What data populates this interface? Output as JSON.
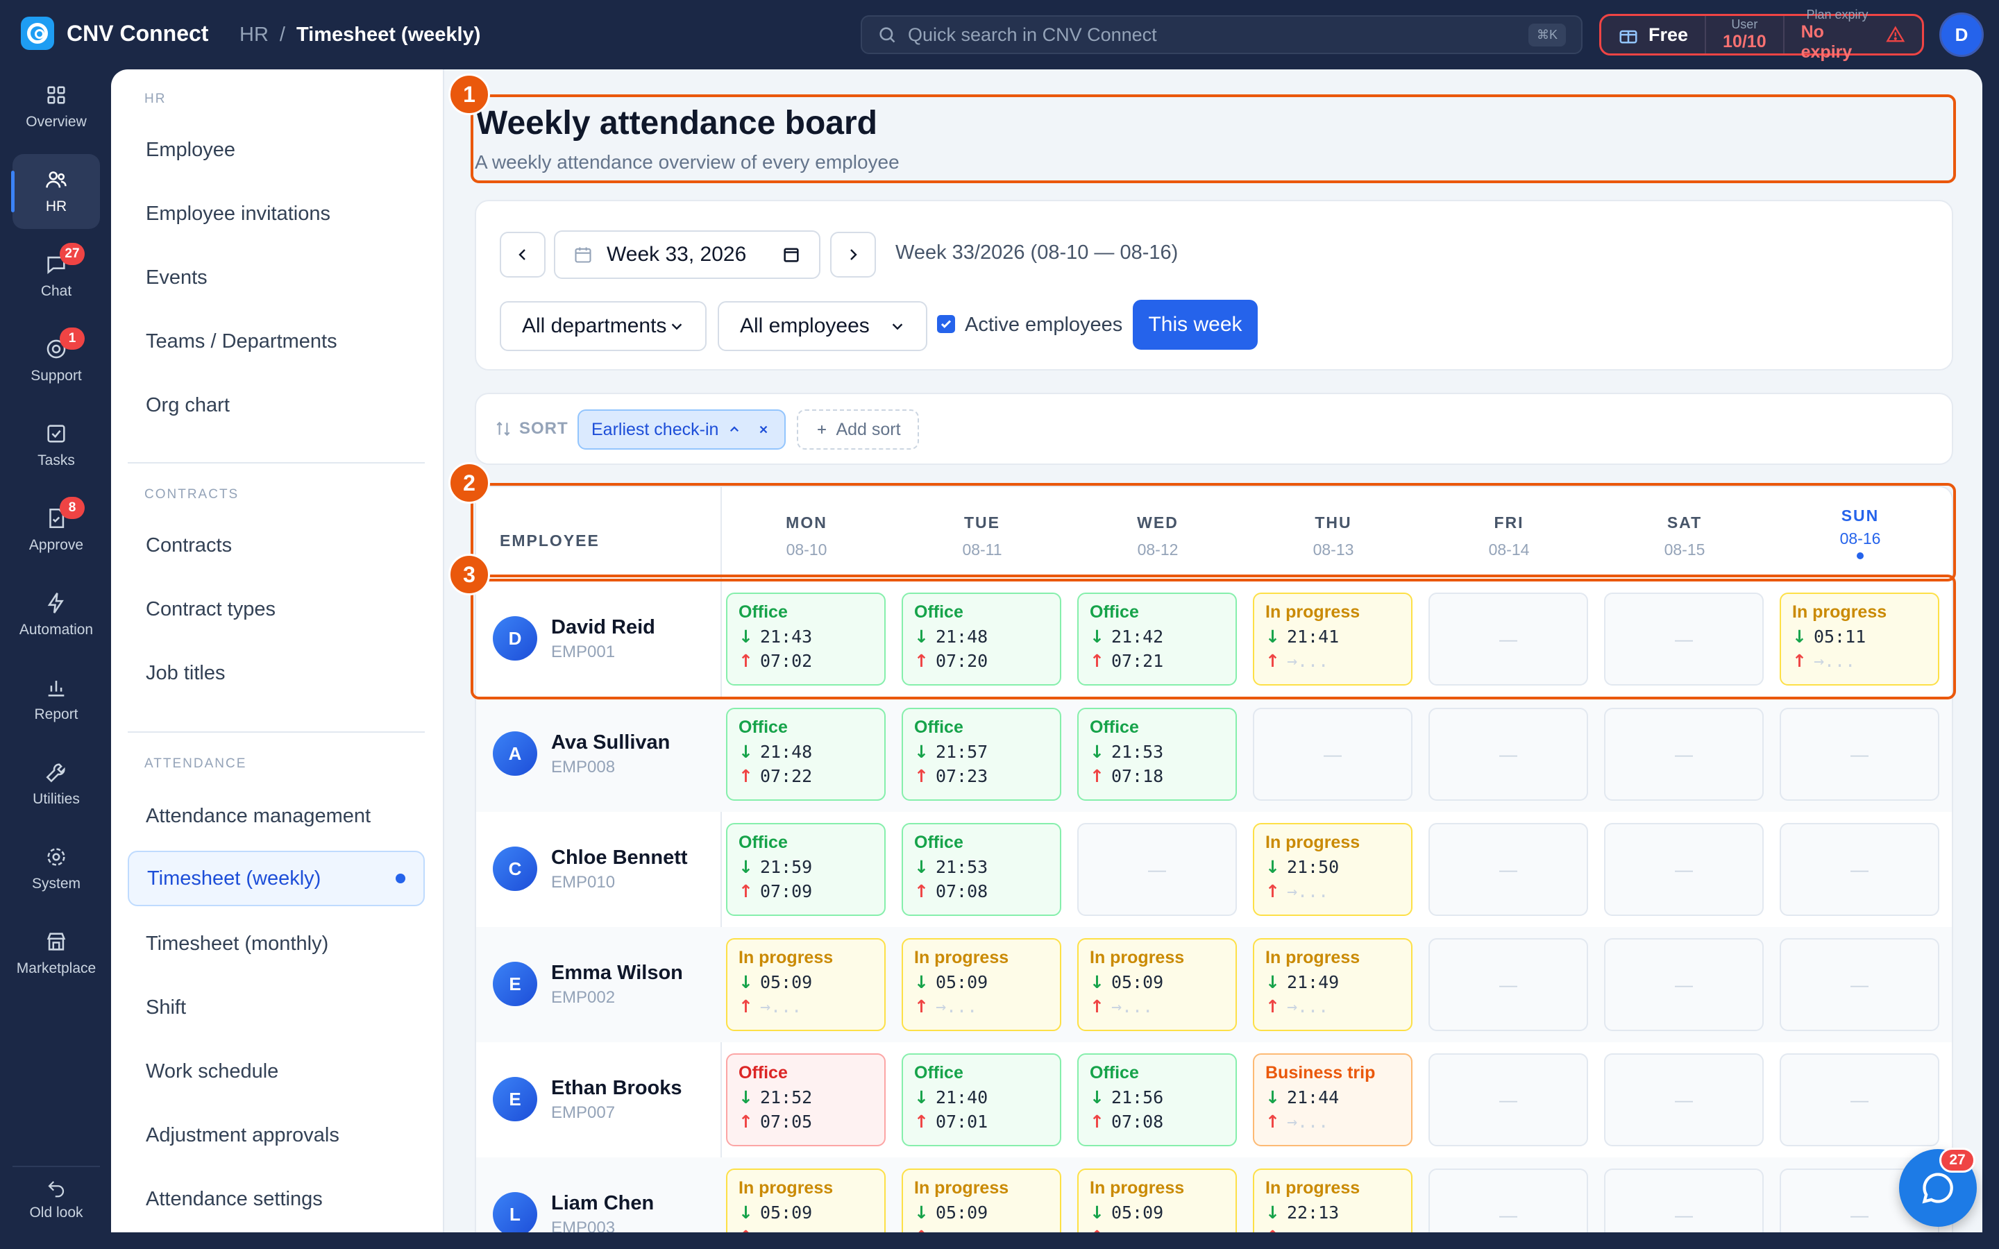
{
  "app": {
    "name": "CNV Connect"
  },
  "breadcrumb": {
    "parent": "HR",
    "separator": "/",
    "current": "Timesheet (weekly)"
  },
  "search": {
    "placeholder": "Quick search in CNV Connect",
    "shortcut": "⌘K"
  },
  "plan": {
    "name": "Free",
    "user_label": "User",
    "user_value": "10/10",
    "expiry_label": "Plan expiry",
    "expiry_value": "No expiry"
  },
  "user": {
    "initial": "D"
  },
  "rail": [
    {
      "label": "Overview",
      "icon": "grid-icon"
    },
    {
      "label": "HR",
      "icon": "users-icon",
      "active": true
    },
    {
      "label": "Chat",
      "icon": "chat-icon",
      "badge": "27"
    },
    {
      "label": "Support",
      "icon": "support-icon",
      "badge": "1"
    },
    {
      "label": "Tasks",
      "icon": "checkbox-icon"
    },
    {
      "label": "Approve",
      "icon": "approve-icon",
      "badge": "8"
    },
    {
      "label": "Automation",
      "icon": "bolt-icon"
    },
    {
      "label": "Report",
      "icon": "bar-chart-icon"
    },
    {
      "label": "Utilities",
      "icon": "wrench-icon"
    },
    {
      "label": "System",
      "icon": "gear-icon"
    },
    {
      "label": "Marketplace",
      "icon": "store-icon"
    }
  ],
  "rail_bottom": {
    "label": "Old look",
    "icon": "undo-icon"
  },
  "subnav": {
    "hr_title": "HR",
    "hr": [
      "Employee",
      "Employee invitations",
      "Events",
      "Teams / Departments",
      "Org chart"
    ],
    "contracts_title": "CONTRACTS",
    "contracts": [
      "Contracts",
      "Contract types",
      "Job titles"
    ],
    "attendance_title": "ATTENDANCE",
    "attendance": [
      "Attendance management",
      "Timesheet (weekly)",
      "Timesheet (monthly)",
      "Shift",
      "Work schedule",
      "Adjustment approvals",
      "Attendance settings"
    ]
  },
  "page": {
    "title": "Weekly attendance board",
    "subtitle": "A weekly attendance overview of every employee"
  },
  "filters": {
    "week_value": "Week 33, 2026",
    "week_range": "Week 33/2026 (08-10 — 08-16)",
    "department": "All departments",
    "employees": "All employees",
    "active_label": "Active employees",
    "active_checked": true,
    "this_week": "This week"
  },
  "sort": {
    "label": "SORT",
    "chip": "Earliest check-in",
    "add": "Add sort"
  },
  "grid": {
    "employee_header": "EMPLOYEE",
    "days": [
      {
        "d": "MON",
        "date": "08-10"
      },
      {
        "d": "TUE",
        "date": "08-11"
      },
      {
        "d": "WED",
        "date": "08-12"
      },
      {
        "d": "THU",
        "date": "08-13"
      },
      {
        "d": "FRI",
        "date": "08-14"
      },
      {
        "d": "SAT",
        "date": "08-15"
      },
      {
        "d": "SUN",
        "date": "08-16",
        "today": true
      }
    ],
    "empty_mark": "—",
    "pending_out": "→...",
    "rows": [
      {
        "initial": "D",
        "name": "David Reid",
        "id": "EMP001",
        "cells": [
          {
            "status": "Office",
            "kind": "office",
            "in": "21:43",
            "out": "07:02"
          },
          {
            "status": "Office",
            "kind": "office",
            "in": "21:48",
            "out": "07:20"
          },
          {
            "status": "Office",
            "kind": "office",
            "in": "21:42",
            "out": "07:21"
          },
          {
            "status": "In progress",
            "kind": "prog",
            "in": "21:41",
            "out": null
          },
          null,
          null,
          {
            "status": "In progress",
            "kind": "prog",
            "in": "05:11",
            "out": null
          }
        ]
      },
      {
        "initial": "A",
        "name": "Ava Sullivan",
        "id": "EMP008",
        "cells": [
          {
            "status": "Office",
            "kind": "office",
            "in": "21:48",
            "out": "07:22"
          },
          {
            "status": "Office",
            "kind": "office",
            "in": "21:57",
            "out": "07:23"
          },
          {
            "status": "Office",
            "kind": "office",
            "in": "21:53",
            "out": "07:18"
          },
          null,
          null,
          null,
          null
        ]
      },
      {
        "initial": "C",
        "name": "Chloe Bennett",
        "id": "EMP010",
        "cells": [
          {
            "status": "Office",
            "kind": "office",
            "in": "21:59",
            "out": "07:09"
          },
          {
            "status": "Office",
            "kind": "office",
            "in": "21:53",
            "out": "07:08"
          },
          null,
          {
            "status": "In progress",
            "kind": "prog",
            "in": "21:50",
            "out": null
          },
          null,
          null,
          null
        ]
      },
      {
        "initial": "E",
        "name": "Emma Wilson",
        "id": "EMP002",
        "cells": [
          {
            "status": "In progress",
            "kind": "prog",
            "in": "05:09",
            "out": null
          },
          {
            "status": "In progress",
            "kind": "prog",
            "in": "05:09",
            "out": null
          },
          {
            "status": "In progress",
            "kind": "prog",
            "in": "05:09",
            "out": null
          },
          {
            "status": "In progress",
            "kind": "prog",
            "in": "21:49",
            "out": null
          },
          null,
          null,
          null
        ]
      },
      {
        "initial": "E",
        "name": "Ethan Brooks",
        "id": "EMP007",
        "cells": [
          {
            "status": "Office",
            "kind": "late",
            "in": "21:52",
            "out": "07:05"
          },
          {
            "status": "Office",
            "kind": "office",
            "in": "21:40",
            "out": "07:01"
          },
          {
            "status": "Office",
            "kind": "office",
            "in": "21:56",
            "out": "07:08"
          },
          {
            "status": "Business trip",
            "kind": "trip",
            "in": "21:44",
            "out": null
          },
          null,
          null,
          null
        ]
      },
      {
        "initial": "L",
        "name": "Liam Chen",
        "id": "EMP003",
        "cells": [
          {
            "status": "In progress",
            "kind": "prog",
            "in": "05:09",
            "out": null
          },
          {
            "status": "In progress",
            "kind": "prog",
            "in": "05:09",
            "out": null
          },
          {
            "status": "In progress",
            "kind": "prog",
            "in": "05:09",
            "out": null
          },
          {
            "status": "In progress",
            "kind": "prog",
            "in": "22:13",
            "out": null
          },
          null,
          null,
          null
        ]
      }
    ]
  },
  "annotations": [
    "1",
    "2",
    "3"
  ],
  "chat_fab": {
    "badge": "27",
    "icon": "chat-bubble-icon"
  },
  "colors": {
    "accent": "#2563eb",
    "annotation": "#ea580c",
    "sidebar_bg": "#1b2846"
  }
}
